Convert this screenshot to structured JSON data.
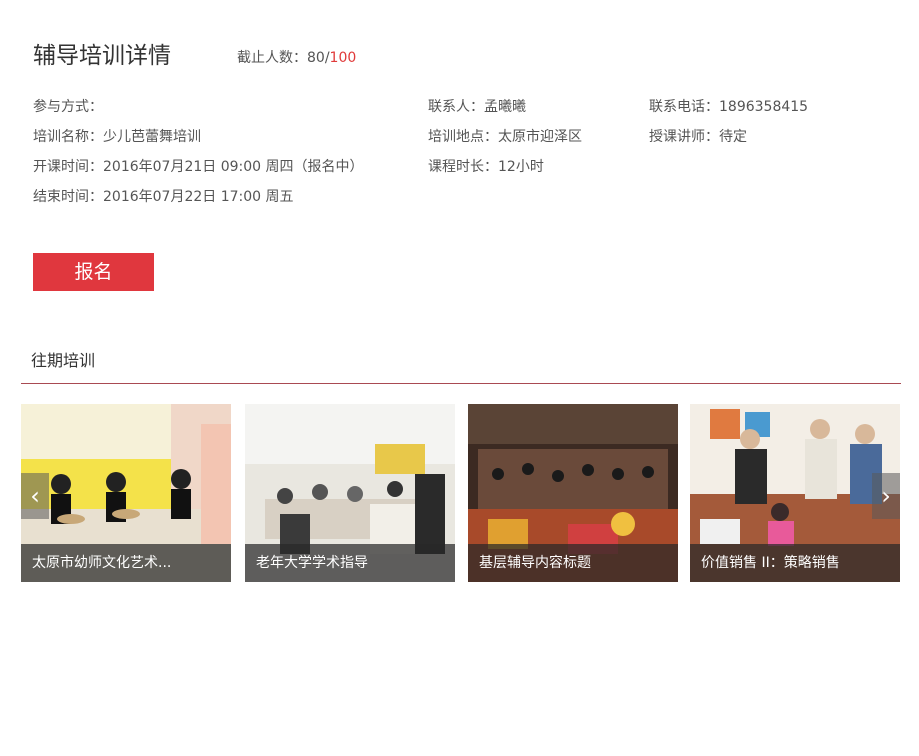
{
  "header": {
    "title": "辅导培训详情",
    "capacity_label": "截止人数：80/",
    "capacity_total": "100"
  },
  "info": {
    "participation": "参与方式：",
    "training_name": "培训名称：少儿芭蕾舞培训",
    "start_time": "开课时间：2016年07月21日 09:00 周四（报名中）",
    "end_time": "结束时间：2016年07月22日 17:00 周五",
    "contact": "联系人：孟曦曦",
    "location": "培训地点：太原市迎泽区",
    "duration": "课程时长：12小时",
    "phone": "联系电话：1896358415",
    "instructor": "授课讲师：待定"
  },
  "actions": {
    "signup": "报名"
  },
  "past": {
    "title": "往期培训",
    "cards": [
      {
        "caption": "太原市幼师文化艺术..."
      },
      {
        "caption": "老年大学学术指导"
      },
      {
        "caption": "基层辅导内容标题"
      },
      {
        "caption": "价值销售 II：策略销售"
      }
    ]
  },
  "carousel": {
    "prev_icon": "chevron-left-icon",
    "next_icon": "chevron-right-icon"
  },
  "colors": {
    "accent": "#e0373e",
    "divider": "#a94a52",
    "highlight": "#e03a3a"
  }
}
